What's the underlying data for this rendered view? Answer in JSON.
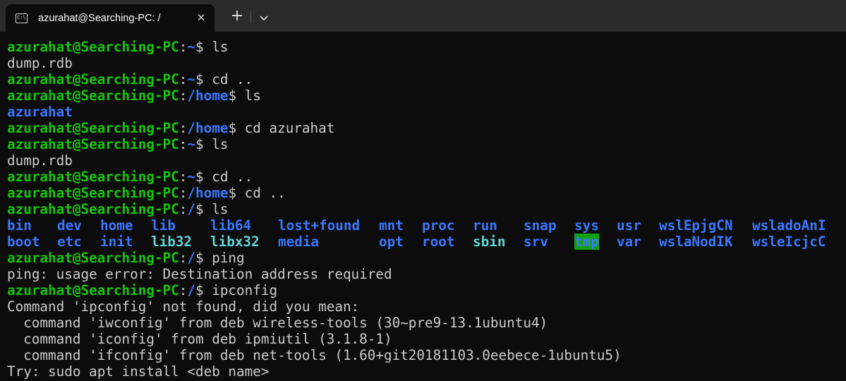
{
  "window": {
    "tab_title": "azurahat@Searching-PC: /",
    "tab_icon": "terminal-icon",
    "close_glyph": "✕",
    "new_tab_glyph": "+"
  },
  "colors": {
    "background": "#0c0c0c",
    "titlebar": "#2b2b2b",
    "prompt_user": "#16c60c",
    "path": "#3b78ff",
    "text": "#cccccc",
    "symlink": "#61d6d6",
    "highlight_bg": "#13a10e"
  },
  "prompt_user": "azurahat@Searching-PC",
  "lines": [
    {
      "path": "~",
      "cmd": "ls"
    },
    {
      "out": "dump.rdb"
    },
    {
      "path": "~",
      "cmd": "cd .."
    },
    {
      "path": "/home",
      "cmd": "ls"
    },
    {
      "dir": "azurahat"
    },
    {
      "path": "/home",
      "cmd": "cd azurahat"
    },
    {
      "path": "~",
      "cmd": "ls"
    },
    {
      "out": "dump.rdb"
    },
    {
      "path": "~",
      "cmd": "cd .."
    },
    {
      "path": "/home",
      "cmd": "cd .."
    },
    {
      "path": "/",
      "cmd": "ls"
    }
  ],
  "ls_row1": [
    "bin",
    "dev",
    "home",
    "lib",
    "lib64",
    "lost+found",
    "mnt",
    "proc",
    "run",
    "snap",
    "sys",
    "usr",
    "wslEpjgCN",
    "wsladoAnI"
  ],
  "ls_row2": [
    "boot",
    "etc",
    "init",
    "lib32",
    "libx32",
    "media",
    "opt",
    "root",
    "sbin",
    "srv",
    "tmp",
    "var",
    "wslaNodIK",
    "wsleIcjcC"
  ],
  "lines2": [
    {
      "path": "/",
      "cmd": "ping"
    },
    {
      "out": "ping: usage error: Destination address required"
    },
    {
      "path": "/",
      "cmd": "ipconfig"
    },
    {
      "out": "Command 'ipconfig' not found, did you mean:"
    },
    {
      "out": "  command 'iwconfig' from deb wireless-tools (30~pre9-13.1ubuntu4)"
    },
    {
      "out": "  command 'iconfig' from deb ipmiutil (3.1.8-1)"
    },
    {
      "out": "  command 'ifconfig' from deb net-tools (1.60+git20181103.0eebece-1ubuntu5)"
    },
    {
      "out": "Try: sudo apt install <deb name>"
    }
  ]
}
